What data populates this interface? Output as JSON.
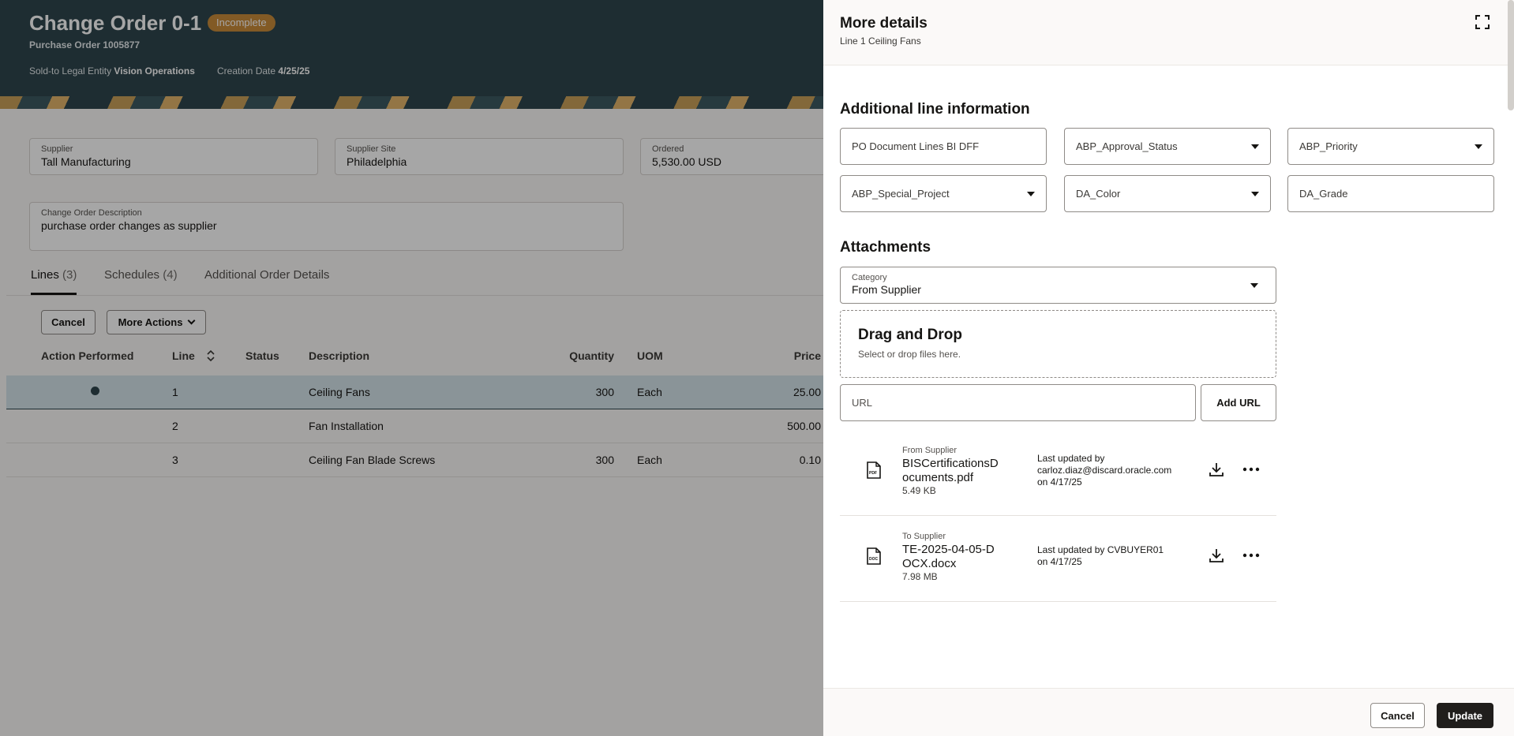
{
  "page": {
    "title": "Change Order 0-1",
    "status_badge": "Incomplete",
    "subtitle": "Purchase Order 1005877",
    "meta": {
      "legal_entity_label": "Sold-to Legal Entity",
      "legal_entity_value": "Vision Operations",
      "creation_date_label": "Creation Date",
      "creation_date_value": "4/25/25"
    },
    "fields": {
      "supplier": {
        "label": "Supplier",
        "value": "Tall Manufacturing"
      },
      "supplier_site": {
        "label": "Supplier Site",
        "value": "Philadelphia"
      },
      "ordered": {
        "label": "Ordered",
        "value": "5,530.00 USD"
      },
      "description": {
        "label": "Change Order Description",
        "value": "purchase order changes as supplier"
      }
    },
    "tabs": [
      {
        "label": "Lines",
        "count": "(3)"
      },
      {
        "label": "Schedules",
        "count": "(4)"
      },
      {
        "label": "Additional Order Details",
        "count": ""
      }
    ],
    "toolbar": {
      "cancel": "Cancel",
      "more_actions": "More Actions"
    },
    "table": {
      "headers": [
        "Action Performed",
        "Line",
        "Status",
        "Description",
        "Quantity",
        "UOM",
        "Price"
      ],
      "rows": [
        {
          "line": "1",
          "status": "",
          "description": "Ceiling Fans",
          "quantity": "300",
          "uom": "Each",
          "price": "25.00"
        },
        {
          "line": "2",
          "status": "",
          "description": "Fan Installation",
          "quantity": "",
          "uom": "",
          "price": "500.00"
        },
        {
          "line": "3",
          "status": "",
          "description": "Ceiling Fan Blade Screws",
          "quantity": "300",
          "uom": "Each",
          "price": "0.10"
        }
      ]
    }
  },
  "drawer": {
    "title": "More details",
    "subtitle": "Line 1 Ceiling Fans",
    "additional_title": "Additional line information",
    "fields": [
      {
        "label": "PO Document Lines BI DFF",
        "dropdown": false
      },
      {
        "label": "ABP_Approval_Status",
        "dropdown": true
      },
      {
        "label": "ABP_Priority",
        "dropdown": true
      },
      {
        "label": "ABP_Special_Project",
        "dropdown": true
      },
      {
        "label": "DA_Color",
        "dropdown": true
      },
      {
        "label": "DA_Grade",
        "dropdown": false
      }
    ],
    "attachments": {
      "title": "Attachments",
      "category_label": "Category",
      "category_value": "From Supplier",
      "drop_title": "Drag and Drop",
      "drop_sub": "Select or drop files here.",
      "url_placeholder": "URL",
      "add_url": "Add URL",
      "files": [
        {
          "category": "From Supplier",
          "name": "BISCertificationsDocuments.pdf",
          "size": "5.49 KB",
          "updated_by": "Last updated by carloz.diaz@discard.oracle.com",
          "updated_on": "on 4/17/25",
          "icon": "pdf-file-icon"
        },
        {
          "category": "To Supplier",
          "name": "TE-2025-04-05-DOCX.docx",
          "size": "7.98 MB",
          "updated_by": "Last updated by CVBUYER01",
          "updated_on": "on 4/17/25",
          "icon": "doc-file-icon"
        }
      ]
    },
    "footer": {
      "cancel": "Cancel",
      "update": "Update"
    }
  },
  "colors": {
    "header_bg": "#2f464d",
    "badge": "#c88a3a",
    "selected_row": "#d5e4ea",
    "primary_button": "#201e1c"
  }
}
